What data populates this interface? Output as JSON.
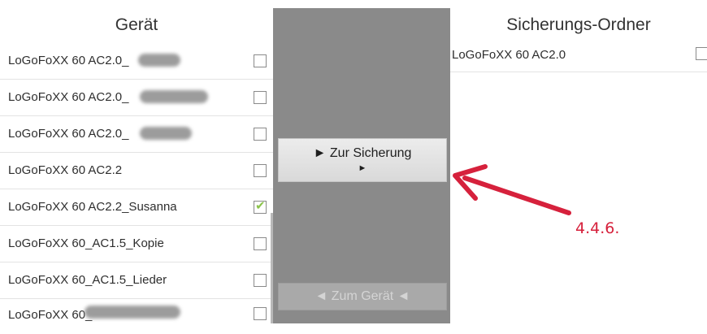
{
  "device_panel": {
    "title": "Gerät",
    "items": [
      {
        "label": "LoGoFoXX 60 AC2.0_",
        "checked": false,
        "redacted": true
      },
      {
        "label": "LoGoFoXX 60 AC2.0_",
        "checked": false,
        "redacted": true
      },
      {
        "label": "LoGoFoXX 60 AC2.0_",
        "checked": false,
        "redacted": true
      },
      {
        "label": "LoGoFoXX 60 AC2.2",
        "checked": false,
        "redacted": false
      },
      {
        "label": "LoGoFoXX 60 AC2.2_Susanna",
        "checked": true,
        "redacted": false
      },
      {
        "label": "LoGoFoXX 60_AC1.5_Kopie",
        "checked": false,
        "redacted": false
      },
      {
        "label": "LoGoFoXX 60_AC1.5_Lieder",
        "checked": false,
        "redacted": false
      },
      {
        "label": "LoGoFoXX 60_",
        "checked": false,
        "redacted": true
      }
    ]
  },
  "transfer": {
    "to_backup_label": "► Zur Sicherung",
    "to_backup_arrow": "►",
    "to_device_label": "◄ Zum Gerät ◄"
  },
  "backup_panel": {
    "title": "Sicherungs-Ordner",
    "items": [
      {
        "label": "LoGoFoXX 60 AC2.0",
        "checked": false
      }
    ]
  },
  "annotation": {
    "text": "4.4.6.",
    "color": "#d6213c"
  }
}
